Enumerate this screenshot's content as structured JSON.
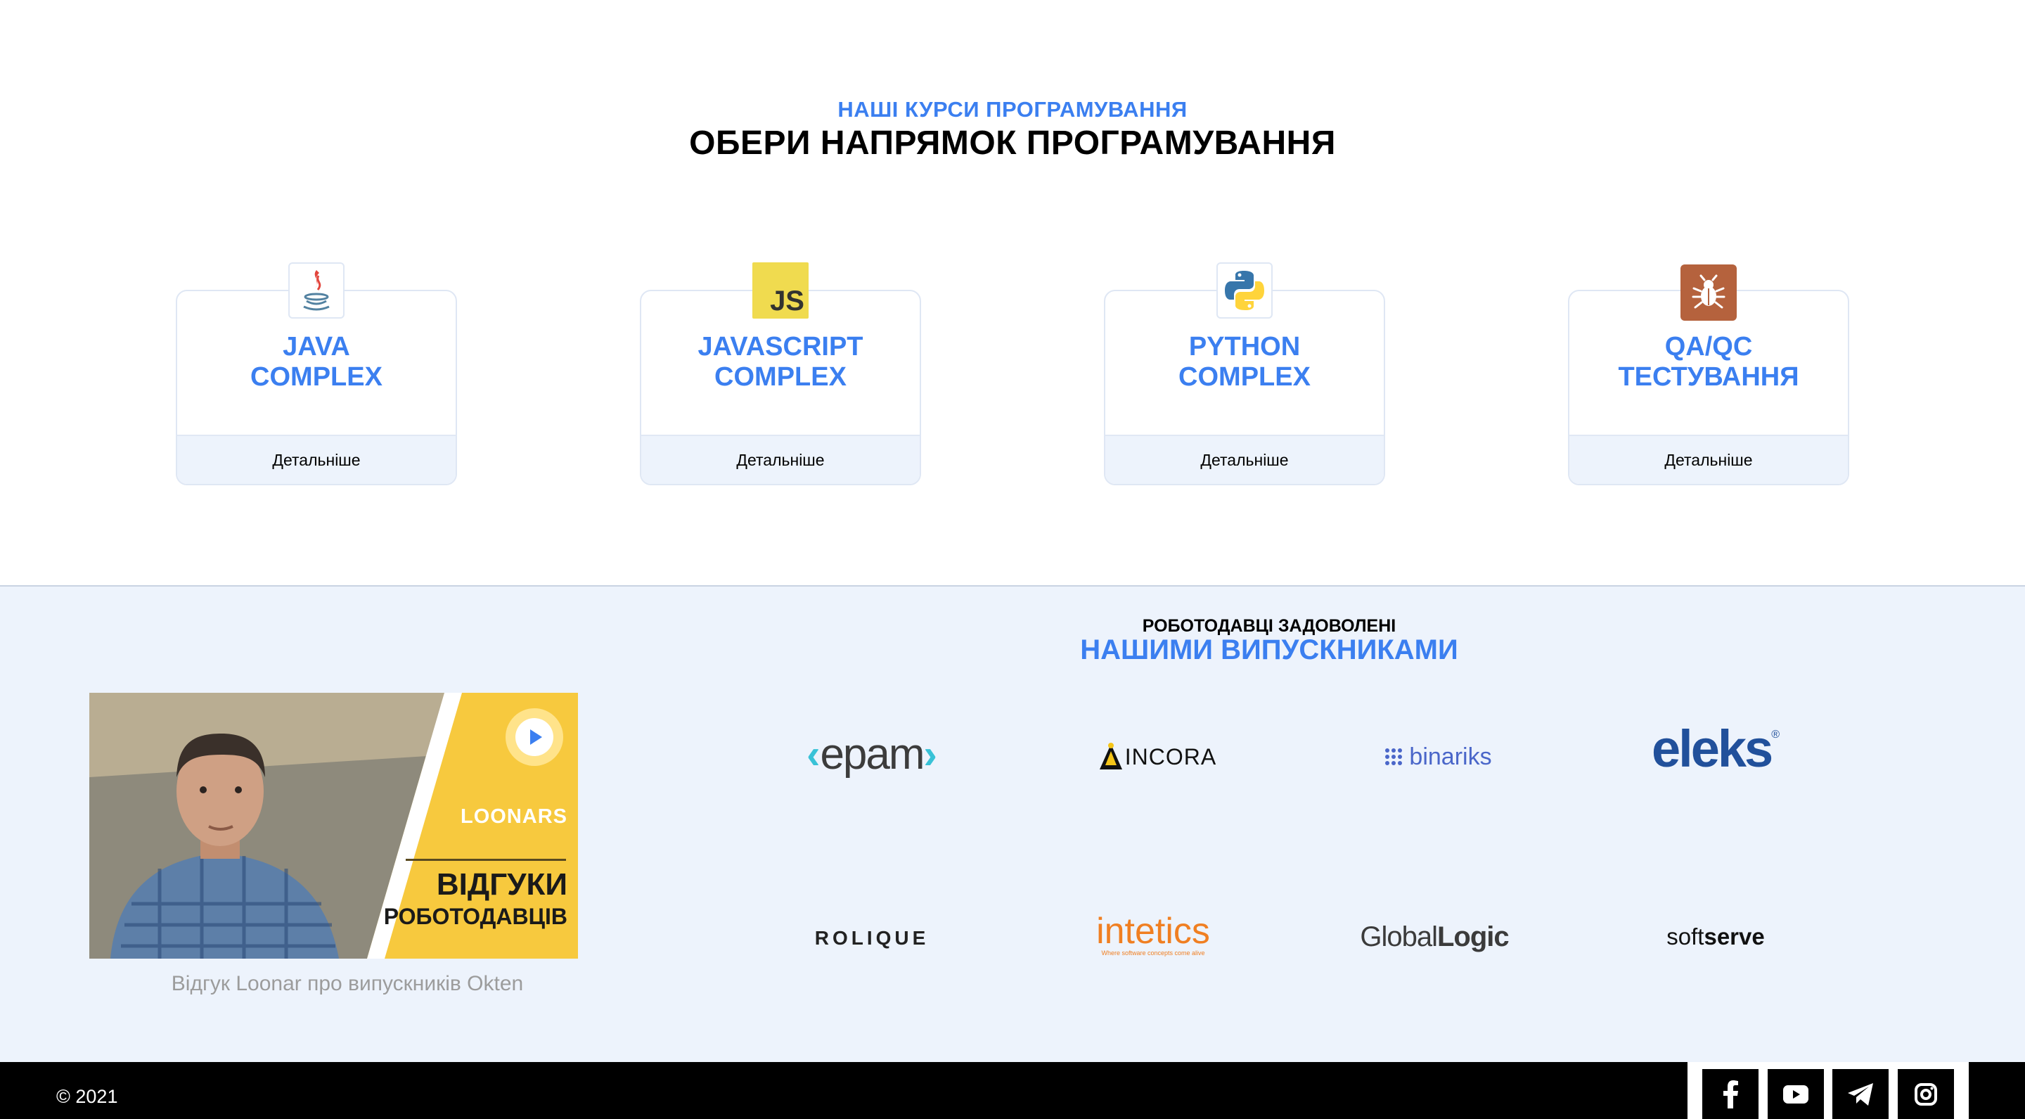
{
  "courses": {
    "subtitle": "НАШІ КУРСИ ПРОГРАМУВАННЯ",
    "title": "ОБЕРИ НАПРЯМОК ПРОГРАМУВАННЯ",
    "items": [
      {
        "line1": "JAVA",
        "line2": "COMPLEX",
        "more": "Детальніше",
        "icon": "java-icon"
      },
      {
        "line1": "JAVASCRIPT",
        "line2": "COMPLEX",
        "more": "Детальніше",
        "icon": "javascript-icon",
        "icon_text": "JS"
      },
      {
        "line1": "PYTHON",
        "line2": "COMPLEX",
        "more": "Детальніше",
        "icon": "python-icon"
      },
      {
        "line1": "QA/QC",
        "line2": "ТЕСТУВАННЯ",
        "more": "Детальніше",
        "icon": "bug-icon"
      }
    ]
  },
  "employers": {
    "subtitle": "РОБОТОДАВЦІ ЗАДОВОЛЕНІ",
    "title": "НАШИМИ ВИПУСКНИКАМИ",
    "video": {
      "brand": "LOONARS",
      "line1": "ВІДГУКИ",
      "line2": "РОБОТОДАВЦІВ",
      "caption": "Відгук Loonar про випускників Okten"
    },
    "logos": {
      "epam": "epam",
      "incora": "INCORA",
      "binariks": "binariks",
      "eleks": "eleks",
      "eleks_mark": "®",
      "rolique": "ROLIQUE",
      "intetics": "intetics",
      "intetics_tagline": "Where software concepts come alive",
      "globallogic_a": "Global",
      "globallogic_b": "Logic",
      "softserve_a": "soft",
      "softserve_b": "serve"
    }
  },
  "footer": {
    "copyright": "© 2021",
    "social": [
      "facebook-icon",
      "youtube-icon",
      "telegram-icon",
      "instagram-icon"
    ]
  },
  "colors": {
    "accent": "#3b7ff0",
    "section_bg": "#edf3fc",
    "footer_bg": "#000000"
  }
}
